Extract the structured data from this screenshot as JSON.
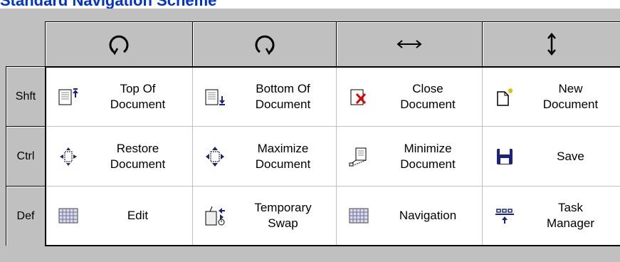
{
  "title": "Standard Navigation Scheme",
  "columns": [
    {
      "icon": "rotate-counterclockwise-icon"
    },
    {
      "icon": "rotate-clockwise-icon"
    },
    {
      "icon": "horizontal-arrow-icon"
    },
    {
      "icon": "vertical-arrow-icon"
    }
  ],
  "rows": [
    {
      "label": "Shft",
      "cells": [
        {
          "label": "Top Of\nDocument",
          "icon": "top-of-document-icon"
        },
        {
          "label": "Bottom Of\nDocument",
          "icon": "bottom-of-document-icon"
        },
        {
          "label": "Close\nDocument",
          "icon": "close-document-icon"
        },
        {
          "label": "New\nDocument",
          "icon": "new-document-icon"
        }
      ]
    },
    {
      "label": "Ctrl",
      "cells": [
        {
          "label": "Restore\nDocument",
          "icon": "restore-document-icon"
        },
        {
          "label": "Maximize\nDocument",
          "icon": "maximize-document-icon"
        },
        {
          "label": "Minimize\nDocument",
          "icon": "minimize-document-icon"
        },
        {
          "label": "Save",
          "icon": "save-icon"
        }
      ]
    },
    {
      "label": "Def",
      "cells": [
        {
          "label": "Edit",
          "icon": "edit-grid-icon"
        },
        {
          "label": "Temporary\nSwap",
          "icon": "temporary-swap-icon"
        },
        {
          "label": "Navigation",
          "icon": "navigation-grid-icon"
        },
        {
          "label": "Task\nManager",
          "icon": "task-manager-icon"
        }
      ]
    }
  ]
}
